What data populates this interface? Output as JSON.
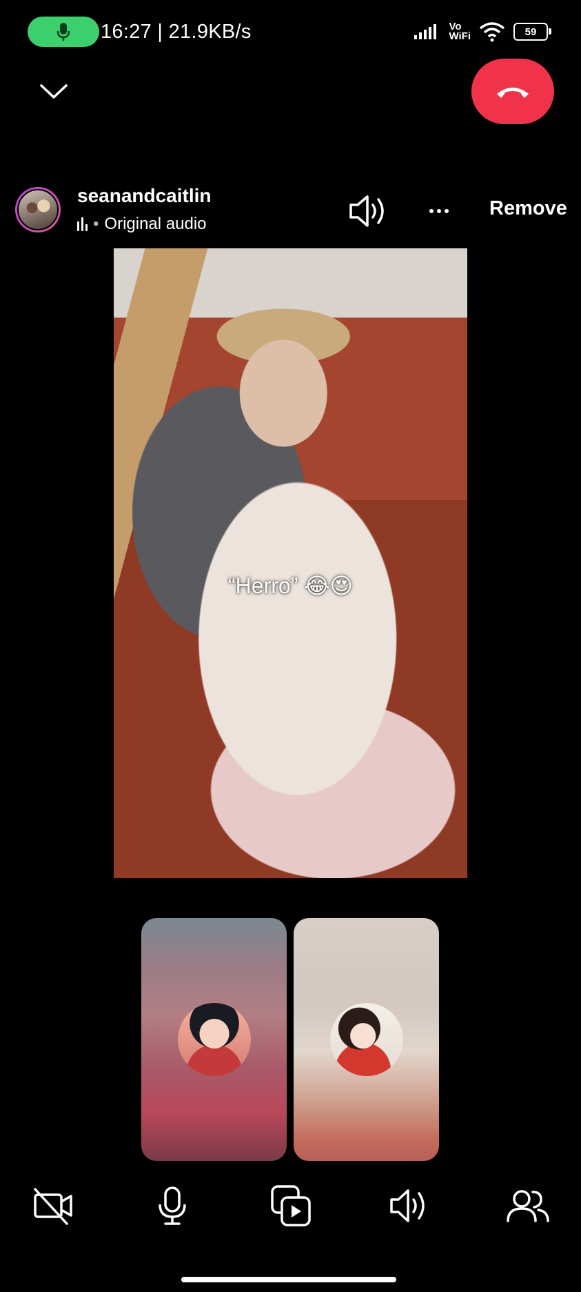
{
  "status_bar": {
    "time_speed": "16:27 | 21.9KB/s",
    "network_label_top": "Vo",
    "network_label_bottom": "WiFi",
    "battery": "59"
  },
  "post": {
    "username": "seanandcaitlin",
    "audio_label": "Original audio",
    "remove_label": "Remove"
  },
  "video": {
    "caption": "“Herro” 😂😍"
  },
  "participants": [
    {
      "avatar": "boy-with-cat-avatar"
    },
    {
      "avatar": "girl-with-bow-avatar"
    }
  ],
  "toolbar": {
    "items": [
      "video-off-icon",
      "mic-icon",
      "share-media-icon",
      "speaker-icon",
      "participants-icon"
    ]
  },
  "colors": {
    "background": "#000000",
    "end_call": "#f0334a",
    "mic_pill": "#3ccf6e"
  }
}
